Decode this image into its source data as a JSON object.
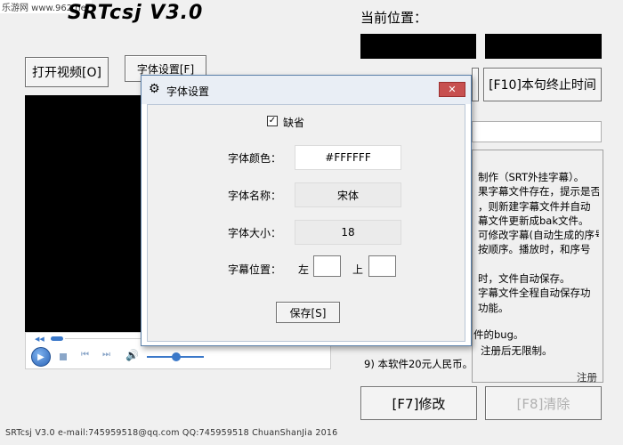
{
  "watermark": "乐游网 www.962.net",
  "app_title": "SRTcsj V3.0",
  "location_label": "当前位置：",
  "buttons": {
    "open_video": "打开视频[O]",
    "font_settings": "字体设置[F]",
    "f10_end": "[F10]本句终止时间",
    "f7_modify": "[F7]修改",
    "f8_partial": "[F8]清除"
  },
  "info_lines": [
    "制作（SRT外挂字幕）。",
    "果字幕文件存在，提示是否",
    "，则新建字幕文件并自动",
    "幕文件更新成bak文件。",
    "可修改字幕(自动生成的序号",
    "按顺序。播放时，和序号",
    "",
    "时，文件自动保存。",
    "字幕文件全程自动保存功",
    "功能。"
  ],
  "lower_lines": [
    "件的bug。",
    "注册后无限制。",
    "9) 本软件20元人民币。"
  ],
  "register_link": "注册",
  "footer": "SRTcsj V3.0    e-mail:745959518@qq.com    QQ:745959518    ChuanShanJia 2016",
  "dialog": {
    "title": "字体设置",
    "close_glyph": "✕",
    "default_label": "缺省",
    "default_checked": true,
    "font_color_label": "字体颜色：",
    "font_color_value": "#FFFFFF",
    "font_name_label": "字体名称：",
    "font_name_value": "宋体",
    "font_size_label": "字体大小：",
    "font_size_value": "18",
    "position_label": "字幕位置：",
    "left_label": "左",
    "top_label": "上",
    "left_value": "",
    "top_value": "",
    "save_button": "保存[S]"
  },
  "player_icons": [
    "play-icon",
    "stop-icon",
    "prev-icon",
    "next-icon",
    "volume-icon"
  ],
  "colors": {
    "dialog_close": "#c75050",
    "player_accent": "#3a78c9",
    "black_panel": "#000000"
  }
}
